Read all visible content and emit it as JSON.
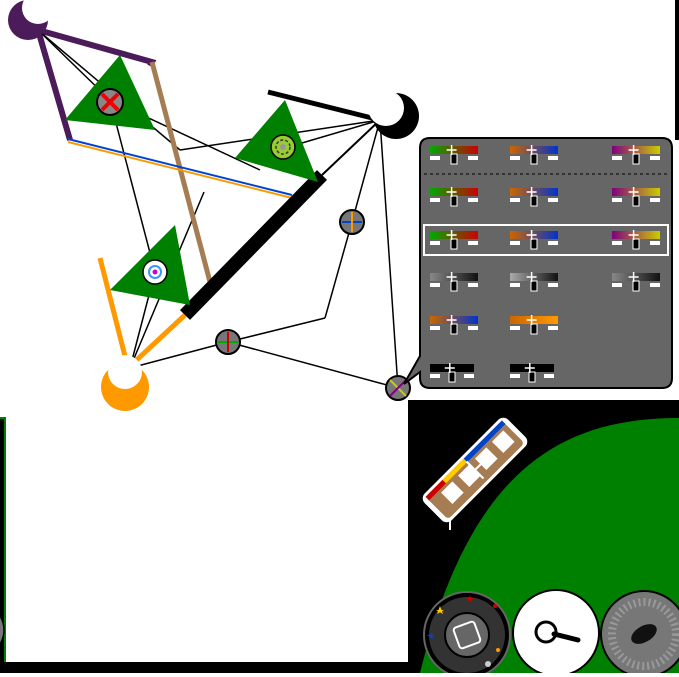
{
  "canvas": {
    "background": "#ffffff",
    "frame_color": "#000000",
    "ground_color": "#008000"
  },
  "nodes": [
    {
      "name": "crescent-purple",
      "color": "#4b1b5a"
    },
    {
      "name": "crescent-black",
      "color": "#000000"
    },
    {
      "name": "crescent-orange",
      "color": "#ff9900"
    }
  ],
  "sprites": [
    {
      "name": "triangle-top-left",
      "icon": "x-circle-icon",
      "color": "#008000"
    },
    {
      "name": "triangle-right",
      "icon": "spiral-icon",
      "color": "#008000"
    },
    {
      "name": "triangle-bottom",
      "icon": "eye-icon",
      "color": "#008000"
    }
  ],
  "joints": [
    {
      "name": "joint-right",
      "icon": "blue-orange-cross-icon"
    },
    {
      "name": "joint-middle",
      "icon": "green-red-cross-icon"
    },
    {
      "name": "joint-bottom",
      "icon": "yellow-purple-cross-icon"
    }
  ],
  "palette": {
    "title": "",
    "rows": 6,
    "gradients": [
      [
        "#00aa00",
        "#cc0000"
      ],
      [
        "#cc6600",
        "#0033cc"
      ],
      [
        "#800080",
        "#cccc00"
      ],
      [
        "#00aa00",
        "#cc0000"
      ],
      [
        "#cc6600",
        "#0033cc"
      ],
      [
        "#800080",
        "#cccc00"
      ],
      [
        "#00aa00",
        "#cc0000"
      ],
      [
        "#cc6600",
        "#0033cc"
      ],
      [
        "#800080",
        "#cccc00"
      ],
      [
        "#888888",
        "#111111"
      ],
      [
        "#aaaaaa",
        "#111111"
      ],
      [
        "#888888",
        "#111111"
      ],
      [
        "#cc6600",
        "#0033cc"
      ],
      [
        "#cc6600",
        "#ff9900"
      ],
      [
        "#000000",
        "#000000"
      ],
      [
        "#000000",
        "#000000"
      ]
    ],
    "selected_row": 3
  },
  "tools": {
    "ruler_icon": "ruler-icon",
    "rotate_dial_icon": "rotate-dial-icon",
    "magnifier_icon": "magnifier-icon",
    "texture_dial_icon": "texture-dial-icon"
  }
}
